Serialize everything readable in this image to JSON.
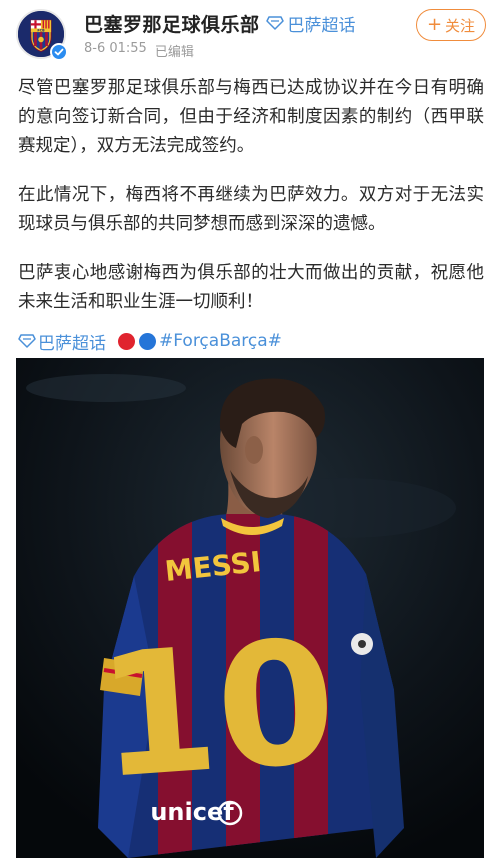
{
  "post": {
    "author": "巴塞罗那足球俱乐部",
    "super_topic": "巴萨超话",
    "time": "8-6 01:55",
    "edited": "已编辑",
    "follow_label": "关注",
    "paragraphs": [
      "尽管巴塞罗那足球俱乐部与梅西已达成协议并在今日有明确的意向签订新合同，但由于经济和制度因素的制约（西甲联赛规定），双方无法完成签约。",
      "在此情况下，梅西将不再继续为巴萨效力。双方对于无法实现球员与俱乐部的共同梦想而感到深深的遗憾。",
      "巴萨衷心地感谢梅西为俱乐部的壮大而做出的贡献，祝愿他未来生活和职业生涯一切顺利！"
    ],
    "topic_link": "巴萨超话",
    "hashtag": "#ForçaBarça#"
  },
  "photo": {
    "jersey_name": "MESSI",
    "jersey_number": "10",
    "sponsor": "unicef"
  },
  "colors": {
    "link": "#4a90d9",
    "follow": "#f08c3c",
    "barca_blue": "#1b3a8f",
    "barca_red": "#a3133a",
    "gold": "#f2c53d"
  },
  "icons": [
    "club-crest-icon",
    "verified-badge-icon",
    "super-topic-icon",
    "plus-icon",
    "red-circle-emoji",
    "blue-circle-emoji"
  ]
}
